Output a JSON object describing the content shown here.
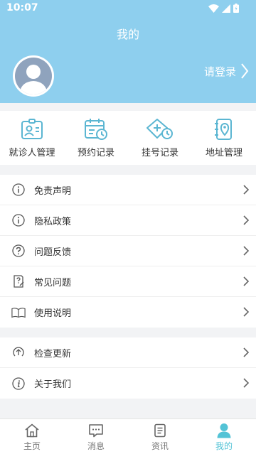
{
  "status_bar": {
    "time": "10:07"
  },
  "header": {
    "title": "我的",
    "login_label": "请登录"
  },
  "quick_actions": [
    {
      "label": "就诊人管理",
      "icon": "patient-card-icon"
    },
    {
      "label": "预约记录",
      "icon": "calendar-clock-icon"
    },
    {
      "label": "挂号记录",
      "icon": "ticket-clock-icon"
    },
    {
      "label": "地址管理",
      "icon": "address-book-icon"
    }
  ],
  "menu_group_1": [
    {
      "label": "免责声明",
      "icon": "info-circle-icon"
    },
    {
      "label": "隐私政策",
      "icon": "info-circle-icon"
    },
    {
      "label": "问题反馈",
      "icon": "question-circle-icon"
    },
    {
      "label": "常见问题",
      "icon": "faq-document-icon"
    },
    {
      "label": "使用说明",
      "icon": "open-book-icon"
    }
  ],
  "menu_group_2": [
    {
      "label": "检查更新",
      "icon": "update-circle-icon"
    },
    {
      "label": "关于我们",
      "icon": "info-italic-circle-icon"
    }
  ],
  "tab_bar": [
    {
      "label": "主页",
      "icon": "home-icon",
      "active": false
    },
    {
      "label": "消息",
      "icon": "message-icon",
      "active": false
    },
    {
      "label": "资讯",
      "icon": "news-icon",
      "active": false
    },
    {
      "label": "我的",
      "icon": "person-icon",
      "active": true
    }
  ],
  "colors": {
    "header_bg": "#8ecfee",
    "accent": "#53c3d6",
    "quick_icon": "#5bb6d2"
  }
}
